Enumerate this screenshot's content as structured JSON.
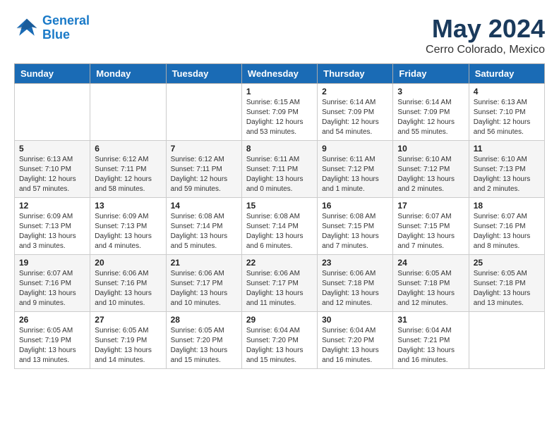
{
  "header": {
    "logo": {
      "line1": "General",
      "line2": "Blue"
    },
    "month": "May 2024",
    "location": "Cerro Colorado, Mexico"
  },
  "weekdays": [
    "Sunday",
    "Monday",
    "Tuesday",
    "Wednesday",
    "Thursday",
    "Friday",
    "Saturday"
  ],
  "weeks": [
    [
      {
        "day": "",
        "content": ""
      },
      {
        "day": "",
        "content": ""
      },
      {
        "day": "",
        "content": ""
      },
      {
        "day": "1",
        "content": "Sunrise: 6:15 AM\nSunset: 7:09 PM\nDaylight: 12 hours\nand 53 minutes."
      },
      {
        "day": "2",
        "content": "Sunrise: 6:14 AM\nSunset: 7:09 PM\nDaylight: 12 hours\nand 54 minutes."
      },
      {
        "day": "3",
        "content": "Sunrise: 6:14 AM\nSunset: 7:09 PM\nDaylight: 12 hours\nand 55 minutes."
      },
      {
        "day": "4",
        "content": "Sunrise: 6:13 AM\nSunset: 7:10 PM\nDaylight: 12 hours\nand 56 minutes."
      }
    ],
    [
      {
        "day": "5",
        "content": "Sunrise: 6:13 AM\nSunset: 7:10 PM\nDaylight: 12 hours\nand 57 minutes."
      },
      {
        "day": "6",
        "content": "Sunrise: 6:12 AM\nSunset: 7:11 PM\nDaylight: 12 hours\nand 58 minutes."
      },
      {
        "day": "7",
        "content": "Sunrise: 6:12 AM\nSunset: 7:11 PM\nDaylight: 12 hours\nand 59 minutes."
      },
      {
        "day": "8",
        "content": "Sunrise: 6:11 AM\nSunset: 7:11 PM\nDaylight: 13 hours\nand 0 minutes."
      },
      {
        "day": "9",
        "content": "Sunrise: 6:11 AM\nSunset: 7:12 PM\nDaylight: 13 hours\nand 1 minute."
      },
      {
        "day": "10",
        "content": "Sunrise: 6:10 AM\nSunset: 7:12 PM\nDaylight: 13 hours\nand 2 minutes."
      },
      {
        "day": "11",
        "content": "Sunrise: 6:10 AM\nSunset: 7:13 PM\nDaylight: 13 hours\nand 2 minutes."
      }
    ],
    [
      {
        "day": "12",
        "content": "Sunrise: 6:09 AM\nSunset: 7:13 PM\nDaylight: 13 hours\nand 3 minutes."
      },
      {
        "day": "13",
        "content": "Sunrise: 6:09 AM\nSunset: 7:13 PM\nDaylight: 13 hours\nand 4 minutes."
      },
      {
        "day": "14",
        "content": "Sunrise: 6:08 AM\nSunset: 7:14 PM\nDaylight: 13 hours\nand 5 minutes."
      },
      {
        "day": "15",
        "content": "Sunrise: 6:08 AM\nSunset: 7:14 PM\nDaylight: 13 hours\nand 6 minutes."
      },
      {
        "day": "16",
        "content": "Sunrise: 6:08 AM\nSunset: 7:15 PM\nDaylight: 13 hours\nand 7 minutes."
      },
      {
        "day": "17",
        "content": "Sunrise: 6:07 AM\nSunset: 7:15 PM\nDaylight: 13 hours\nand 7 minutes."
      },
      {
        "day": "18",
        "content": "Sunrise: 6:07 AM\nSunset: 7:16 PM\nDaylight: 13 hours\nand 8 minutes."
      }
    ],
    [
      {
        "day": "19",
        "content": "Sunrise: 6:07 AM\nSunset: 7:16 PM\nDaylight: 13 hours\nand 9 minutes."
      },
      {
        "day": "20",
        "content": "Sunrise: 6:06 AM\nSunset: 7:16 PM\nDaylight: 13 hours\nand 10 minutes."
      },
      {
        "day": "21",
        "content": "Sunrise: 6:06 AM\nSunset: 7:17 PM\nDaylight: 13 hours\nand 10 minutes."
      },
      {
        "day": "22",
        "content": "Sunrise: 6:06 AM\nSunset: 7:17 PM\nDaylight: 13 hours\nand 11 minutes."
      },
      {
        "day": "23",
        "content": "Sunrise: 6:06 AM\nSunset: 7:18 PM\nDaylight: 13 hours\nand 12 minutes."
      },
      {
        "day": "24",
        "content": "Sunrise: 6:05 AM\nSunset: 7:18 PM\nDaylight: 13 hours\nand 12 minutes."
      },
      {
        "day": "25",
        "content": "Sunrise: 6:05 AM\nSunset: 7:18 PM\nDaylight: 13 hours\nand 13 minutes."
      }
    ],
    [
      {
        "day": "26",
        "content": "Sunrise: 6:05 AM\nSunset: 7:19 PM\nDaylight: 13 hours\nand 13 minutes."
      },
      {
        "day": "27",
        "content": "Sunrise: 6:05 AM\nSunset: 7:19 PM\nDaylight: 13 hours\nand 14 minutes."
      },
      {
        "day": "28",
        "content": "Sunrise: 6:05 AM\nSunset: 7:20 PM\nDaylight: 13 hours\nand 15 minutes."
      },
      {
        "day": "29",
        "content": "Sunrise: 6:04 AM\nSunset: 7:20 PM\nDaylight: 13 hours\nand 15 minutes."
      },
      {
        "day": "30",
        "content": "Sunrise: 6:04 AM\nSunset: 7:20 PM\nDaylight: 13 hours\nand 16 minutes."
      },
      {
        "day": "31",
        "content": "Sunrise: 6:04 AM\nSunset: 7:21 PM\nDaylight: 13 hours\nand 16 minutes."
      },
      {
        "day": "",
        "content": ""
      }
    ]
  ]
}
